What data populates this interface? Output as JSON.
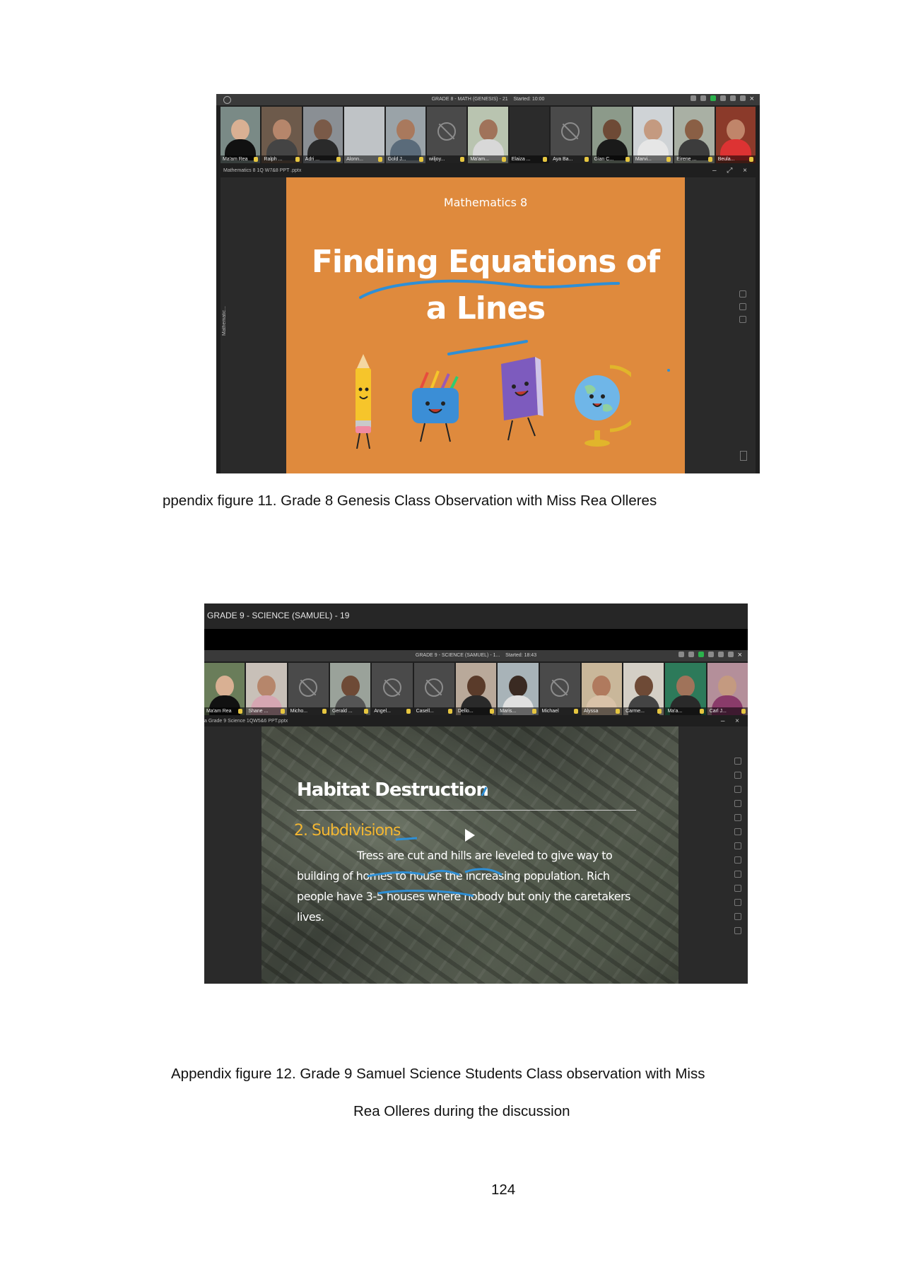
{
  "figure1": {
    "meeting_title": "GRADE 8 - MATH (GENESIS) - 21",
    "started": "Started: 10:00",
    "participants": [
      "Ma'am Rea",
      "Ralph ...",
      "Adri ...",
      "Alonn...",
      "Gold J...",
      "wiljoy...",
      "Ma'am...",
      "Elaiza ...",
      "Aya Ba...",
      "Gian C...",
      "Marvi...",
      "Eirene ...",
      "Beula..."
    ],
    "document_name": "Mathematics 8 1Q W7&8 PPT .pptx",
    "side_tab": "Mathematic...",
    "slide": {
      "subtitle": "Mathematics 8",
      "title_line1": "Finding Equations of",
      "title_line2": "a Lines"
    },
    "caption": "ppendix figure 11. Grade 8 Genesis Class Observation with Miss Rea Olleres"
  },
  "figure2": {
    "window_title": "GRADE 9 - SCIENCE (SAMUEL) - 19",
    "meeting_title": "GRADE 9 - SCIENCE (SAMUEL) - 1...",
    "started": "Started: 18:43",
    "participants": [
      "Ma'am Rea",
      "Shane ...",
      "Micho...",
      "Gerald ...",
      "Angel...",
      "Casell...",
      "Dello...",
      "Maris...",
      "Michael",
      "Alyssa",
      "Carme...",
      "Ma'a...",
      "Carl J..."
    ],
    "document_name": "a Grade 9 Science 1QW5&6 PPT.pptx",
    "slide": {
      "title": "Habitat Destruction",
      "subheading": "2. Subdivisions",
      "body_line1": "Tress are cut and hills are leveled to give way to",
      "body_line2": "building of homes to house the increasing population. Rich",
      "body_line3": "people have 3-5 houses where nobody but only the caretakers",
      "body_line4": "lives."
    },
    "caption_line1": "Appendix figure 12. Grade 9 Samuel Science Students Class observation with Miss",
    "caption_line2": "Rea Olleres during the discussion"
  },
  "page_number": "124"
}
